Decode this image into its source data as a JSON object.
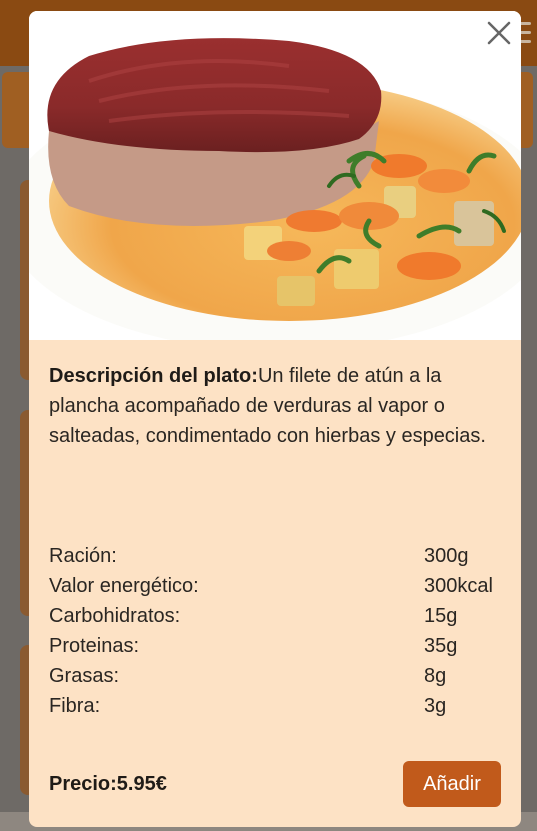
{
  "modal": {
    "image_alt": "Filete de atún a la plancha con verduras",
    "description_label": "Descripción del plato:",
    "description_text": "Un filete de atún a la plancha acompañado de verduras al vapor o salteadas, condimentado con hierbas y especias.",
    "nutrition": [
      {
        "label": "Ración:",
        "value": "300g"
      },
      {
        "label": "Valor energético:",
        "value": "300kcal"
      },
      {
        "label": "Carbohidratos:",
        "value": "15g"
      },
      {
        "label": "Proteinas:",
        "value": "35g"
      },
      {
        "label": "Grasas:",
        "value": "8g"
      },
      {
        "label": "Fibra:",
        "value": "3g"
      }
    ],
    "price": "Precio:5.95€",
    "add_button": "Añadir"
  },
  "colors": {
    "modal_bg": "#fde2c5",
    "accent": "#c15a1b",
    "header": "#8a4a12"
  },
  "icons": {
    "close": "close-icon",
    "menu": "hamburger-menu-icon"
  }
}
